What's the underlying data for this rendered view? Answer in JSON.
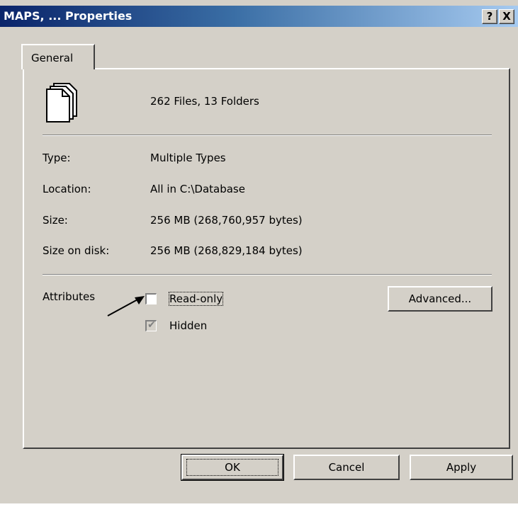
{
  "window": {
    "title": "MAPS, ... Properties",
    "help_button": "?",
    "close_button": "X"
  },
  "tabs": [
    {
      "label": "General"
    }
  ],
  "summary": {
    "icon": "files-stack-icon",
    "text": "262 Files, 13 Folders"
  },
  "properties": {
    "type_label": "Type:",
    "type_value": "Multiple Types",
    "location_label": "Location:",
    "location_value": "All in C:\\Database",
    "size_label": "Size:",
    "size_value": "256 MB (268,760,957 bytes)",
    "size_on_disk_label": "Size on disk:",
    "size_on_disk_value": "256 MB (268,829,184 bytes)"
  },
  "attributes": {
    "label": "Attributes",
    "read_only": {
      "label": "Read-only",
      "checked": false
    },
    "hidden": {
      "label": "Hidden",
      "checked": true,
      "disabled": true
    },
    "advanced_button": "Advanced..."
  },
  "footer": {
    "ok_label": "OK",
    "cancel_label": "Cancel",
    "apply_label": "Apply"
  },
  "colors": {
    "face": "#d4d0c8",
    "title_start": "#0a246a",
    "title_end": "#a6caf0"
  }
}
